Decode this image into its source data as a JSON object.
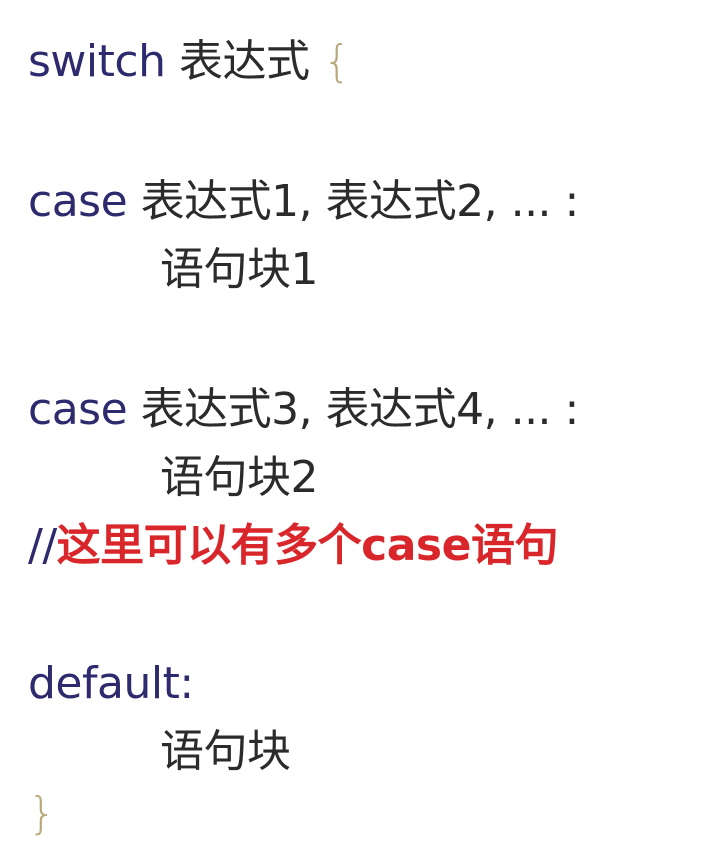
{
  "code": {
    "switch_kw": "switch",
    "switch_expr": "表达式",
    "open_brace": "{",
    "case1_kw": "case",
    "case1_exprs": "表达式1, 表达式2, ... :",
    "block1": "语句块1",
    "case2_kw": "case",
    "case2_exprs": "表达式3, 表达式4, ... :",
    "block2": "语句块2",
    "comment_slashes": "//",
    "comment_text": "这里可以有多个case语句",
    "default_kw": "default:",
    "default_block": "语句块",
    "close_brace": "}"
  },
  "colors": {
    "keyword": "#2d2a6e",
    "text": "#2b2b2b",
    "brace": "#b8a77a",
    "comment": "#d9262b"
  }
}
